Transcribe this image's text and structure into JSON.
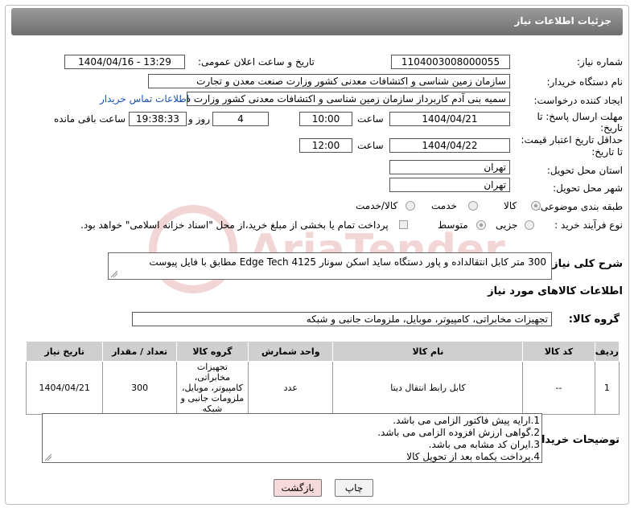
{
  "title": "جزئیات اطلاعات نیاز",
  "fields": {
    "need_number_label": "شماره نیاز:",
    "need_number": "1104003008000055",
    "announce_label": "تاریخ و ساعت اعلان عمومی:",
    "announce_value": "1404/04/16 - 13:29",
    "buyer_org_label": "نام دستگاه خریدار:",
    "buyer_org": "سازمان زمین شناسی و اکتشافات معدنی کشور وزارت صنعت معدن و تجارت",
    "requester_label": "ایجاد کننده درخواست:",
    "requester": "سمیه بنی آدم کاربرداز سازمان زمین شناسی و اکتشافات معدنی کشور وزارت د",
    "contact_link": "اطلاعات تماس خریدار",
    "deadline_label_1": "مهلت ارسال پاسخ: تا",
    "deadline_label_2": "تاریخ:",
    "deadline_date": "1404/04/21",
    "time_label": "ساعت",
    "deadline_time": "10:00",
    "days_value": "4",
    "days_label": "روز و",
    "remaining_time": "19:38:33",
    "remaining_label": "ساعت باقی مانده",
    "price_label_1": "حداقل تاریخ اعتبار قیمت:",
    "price_label_2": "تا تاریخ:",
    "price_date": "1404/04/22",
    "price_time": "12:00",
    "province_label": "استان محل تحویل:",
    "province": "تهران",
    "city_label": "شهر محل تحویل:",
    "city": "تهران",
    "category_label": "طبقه بندی موضوعی:",
    "category_options": [
      "کالا",
      "خدمت",
      "کالا/خدمت"
    ],
    "process_label": "نوع فرآیند خرید :",
    "process_options": [
      "جزیی",
      "متوسط"
    ],
    "payment_note": "پرداخت تمام یا بخشی از مبلغ خرید،از محل \"اسناد خزانه اسلامی\" خواهد بود."
  },
  "description": {
    "label": "شرح کلی نیاز:",
    "text": "300 متر کابل انتقالداده و پاور دستگاه ساید اسکن سونار Edge Tech 4125  مطابق با فایل پیوست"
  },
  "goods_section": {
    "heading": "اطلاعات کالاهای مورد نیاز",
    "group_label": "گروه کالا:",
    "group_value": "تجهیزات مخابراتی، کامپیوتر، موبایل، ملزومات جانبی و شبکه"
  },
  "table": {
    "headers": [
      "ردیف",
      "کد کالا",
      "نام کالا",
      "واحد شمارش",
      "گروه کالا",
      "تعداد / مقدار",
      "تاریخ نیاز"
    ],
    "rows": [
      [
        "1",
        "--",
        "کابل رابط انتقال دیتا",
        "عدد",
        "تجهیزات مخابراتی، کامپیوتر، موبایل، ملزومات جانبی و شبکه",
        "300",
        "1404/04/21"
      ]
    ]
  },
  "buyer_notes": {
    "label": "توضیحات خریدار:",
    "lines": [
      "1.ارایه پیش فاکتور الزامی می باشد.",
      "2.گواهی ارزش افزوده الزامی می باشد.",
      "3.ایران کد مشابه می باشد.",
      "4.پرداخت یکماه بعد از تحویل کالا"
    ]
  },
  "buttons": {
    "print": "چاپ",
    "back": "بازگشت"
  },
  "colors": {
    "title_bar": "#7d7d7d",
    "link": "#1a4fb5",
    "back_button": "#f6d9da",
    "watermark": "#e8a0a0"
  }
}
